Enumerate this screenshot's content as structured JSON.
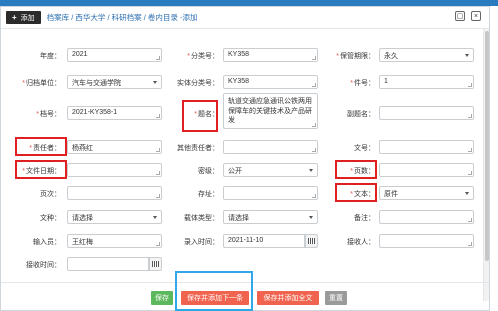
{
  "header": {
    "add_label": "添加",
    "breadcrumb": "档案库 / 西华大学 / 科研档案 / 卷内目录 -添加",
    "close_glyph": "×",
    "maximize_glyph": "▢"
  },
  "form": {
    "year": {
      "label": "年度：",
      "value": "2021"
    },
    "category_no": {
      "label": "分类号：",
      "value": "KY358"
    },
    "retention": {
      "label": "保管期限：",
      "value": "永久"
    },
    "archive_unit": {
      "label": "归档单位：",
      "value": "汽车与交通学院"
    },
    "entity_category_no": {
      "label": "实体分类号：",
      "value": "KY358"
    },
    "item_no": {
      "label": "件号：",
      "value": "1"
    },
    "file_no": {
      "label": "档号：",
      "value": "2021-KY358-1"
    },
    "title": {
      "label": "题名：",
      "value": "轨道交通应急通讯公铁两用保障车的关键技术及产品研发"
    },
    "subtitle": {
      "label": "副题名：",
      "value": ""
    },
    "responsible": {
      "label": "责任者：",
      "value": "杨燕红"
    },
    "other_responsible": {
      "label": "其他责任者：",
      "value": ""
    },
    "doc_no": {
      "label": "文号：",
      "value": ""
    },
    "file_date": {
      "label": "文件日期：",
      "value": ""
    },
    "secrecy": {
      "label": "密级：",
      "value": "公开"
    },
    "page_count": {
      "label": "页数：",
      "value": ""
    },
    "page_order": {
      "label": "页次：",
      "value": ""
    },
    "location": {
      "label": "存址：",
      "value": ""
    },
    "text_type": {
      "label": "文本：",
      "value": "原件"
    },
    "doc_type": {
      "label": "文种：",
      "value": "请选择"
    },
    "carrier_type": {
      "label": "载体类型：",
      "value": "请选择"
    },
    "remarks": {
      "label": "备注：",
      "value": ""
    },
    "inputter": {
      "label": "输入员：",
      "value": "王红梅"
    },
    "input_time": {
      "label": "录入时间：",
      "value": "2021-11-10"
    },
    "receiver": {
      "label": "接收人：",
      "value": ""
    },
    "receive_time": {
      "label": "接收时间：",
      "value": ""
    }
  },
  "buttons": {
    "save": "保存",
    "save_next": "保存并添加下一条",
    "save_fulltext": "保存并添加全文",
    "reset": "重置"
  },
  "colors": {
    "save": "#5cb85c",
    "save_next": "#f0644f",
    "save_fulltext": "#f0644f",
    "reset": "#9a9a9a",
    "highlight": "#e02020",
    "highlight_blue": "#2ea8e6"
  }
}
